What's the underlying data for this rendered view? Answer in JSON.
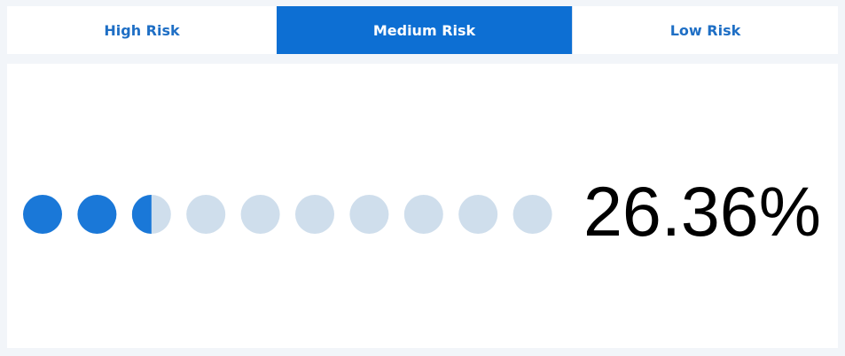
{
  "tabs": [
    {
      "label": "High Risk",
      "active": false
    },
    {
      "label": "Medium Risk",
      "active": true
    },
    {
      "label": "Low Risk",
      "active": false
    }
  ],
  "indicator": {
    "dot_count": 10,
    "filled_dots": 2.5,
    "percentage_text": "26.36%"
  },
  "colors": {
    "accent": "#0d6fd3",
    "dot_filled": "#1a78d8",
    "dot_empty": "#cfdeec",
    "tab_text": "#1f6fc5"
  }
}
